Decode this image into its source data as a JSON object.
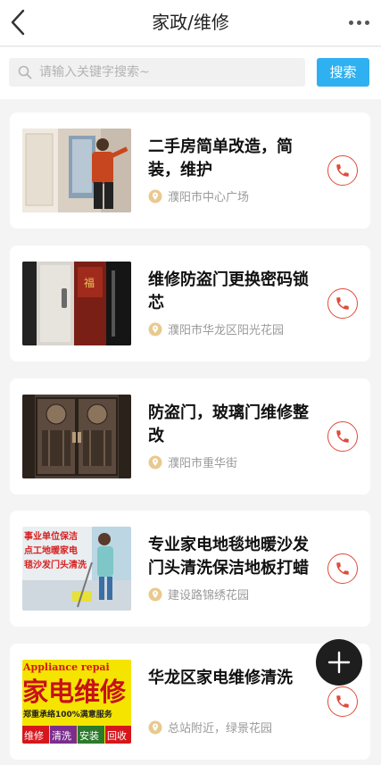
{
  "header": {
    "title": "家政/维修"
  },
  "search": {
    "placeholder": "请输入关键字搜索~",
    "value": "",
    "button_label": "搜索"
  },
  "accent_color": "#2fb0f0",
  "phone_color": "#e04b3a",
  "listings": [
    {
      "title": "二手房简单改造，简装，维护",
      "location": "濮阳市中心广场",
      "image": "renovation-worker-photo"
    },
    {
      "title": "维修防盗门更换密码锁芯",
      "location": "濮阳市华龙区阳光花园",
      "image": "security-door-lock-photo"
    },
    {
      "title": "防盗门，玻璃门维修整改",
      "location": "濮阳市重华街",
      "image": "ornate-metal-door-photo"
    },
    {
      "title": "专业家电地毯地暖沙发门头清洗保洁地板打蜡",
      "location": "建设路锦绣花园",
      "image": "cleaning-service-photo",
      "image_text": [
        "事业单位保洁",
        "点工地暖家电",
        "毯沙发门头清洗"
      ]
    },
    {
      "title": "华龙区家电维修清洗",
      "location": "总站附近，绿景花园",
      "image": "appliance-repair-banner",
      "image_text": [
        "Appliance repai",
        "家电维修",
        "郑重承络100%满意服务",
        "维修",
        "清洗",
        "安装",
        "回收"
      ]
    }
  ]
}
